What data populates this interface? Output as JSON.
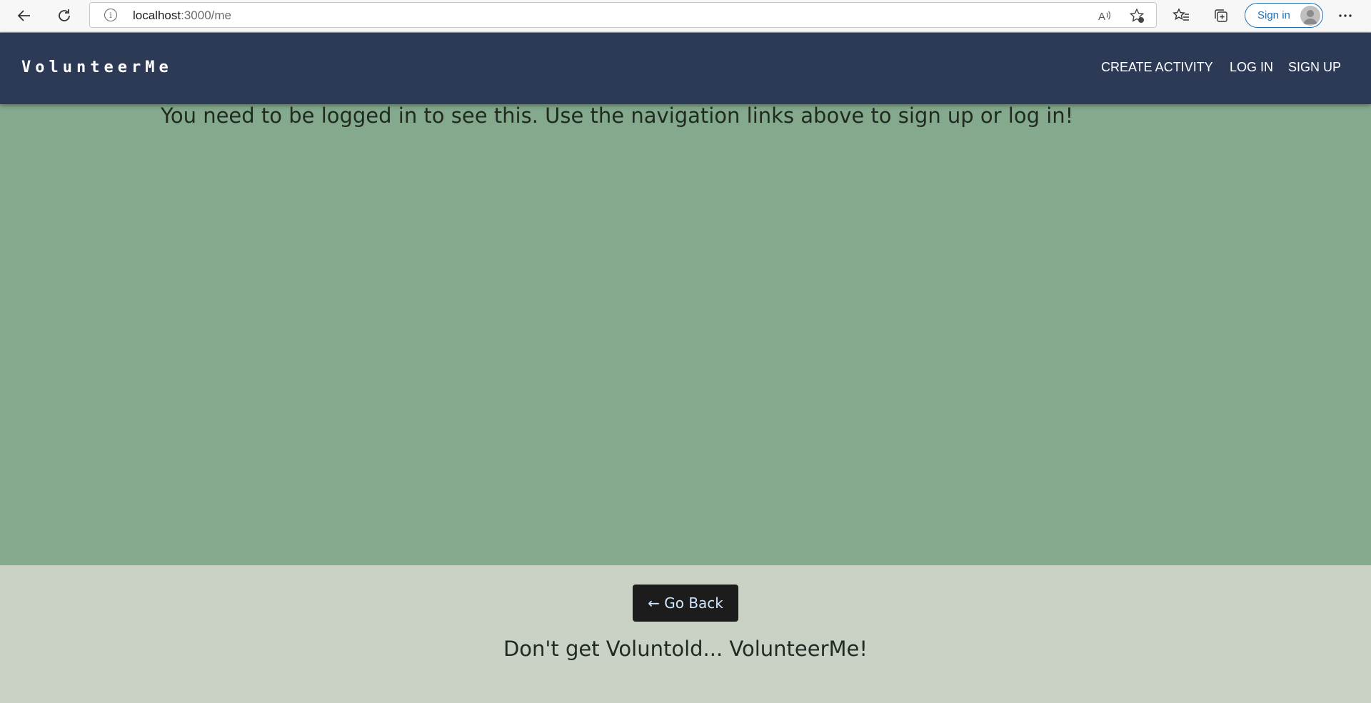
{
  "browser": {
    "url_host": "localhost",
    "url_path": ":3000/me",
    "signin_label": "Sign in"
  },
  "icons": {
    "back": "back-arrow-icon",
    "reload": "reload-icon",
    "info": "info-icon",
    "read_aloud": "read-aloud-icon",
    "add_favorite": "add-favorite-icon",
    "favorites": "favorites-icon",
    "collections": "collections-icon",
    "profile": "profile-avatar-icon",
    "more": "more-options-icon"
  },
  "header": {
    "brand": "VolunteerMe",
    "nav": [
      {
        "label": "CREATE ACTIVITY"
      },
      {
        "label": "LOG IN"
      },
      {
        "label": "SIGN UP"
      }
    ]
  },
  "main": {
    "message": "You need to be logged in to see this. Use the navigation links above to sign up or log in!"
  },
  "footer": {
    "back_button_label": "← Go Back",
    "tagline": "Don't get Voluntold... VolunteerMe!"
  },
  "colors": {
    "header_bg": "#2d3a56",
    "main_bg": "#84a98c",
    "footer_bg": "#cad2c5",
    "button_bg": "#1c1c1c"
  }
}
